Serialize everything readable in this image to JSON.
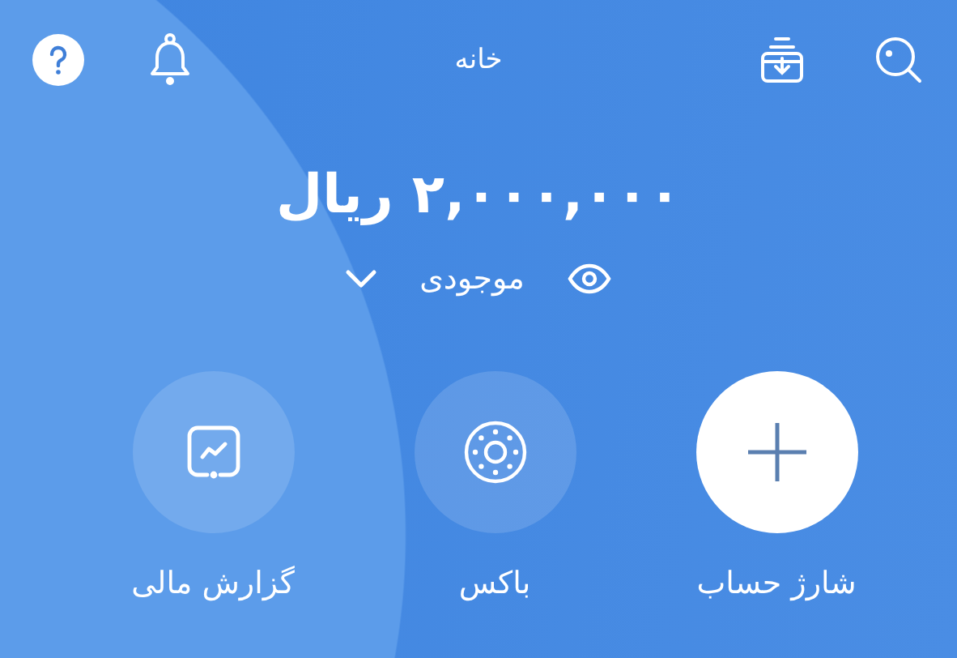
{
  "header": {
    "title": "خانه"
  },
  "balance": {
    "amount": "۲,۰۰۰,۰۰۰ ریال",
    "label": "موجودی"
  },
  "actions": [
    {
      "label": "شارژ حساب",
      "kind": "plus",
      "primary": true
    },
    {
      "label": "باکس",
      "kind": "box",
      "primary": false
    },
    {
      "label": "گزارش مالی",
      "kind": "report",
      "primary": false
    }
  ]
}
